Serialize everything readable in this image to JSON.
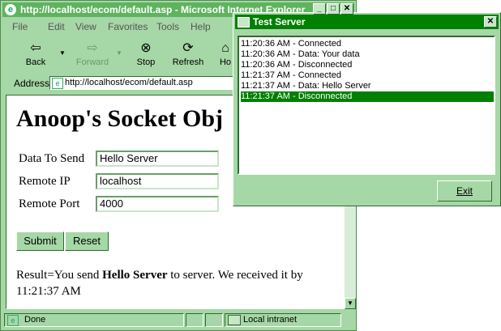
{
  "ie": {
    "title": "http://localhost/ecom/default.asp - Microsoft Internet Explorer",
    "menu": [
      "File",
      "Edit",
      "View",
      "Favorites",
      "Tools",
      "Help"
    ],
    "toolbar": {
      "back": "Back",
      "forward": "Forward",
      "stop": "Stop",
      "refresh": "Refresh",
      "home": "Ho"
    },
    "address": {
      "label": "Address",
      "url": "http://localhost/ecom/default.asp"
    },
    "page": {
      "heading": "Anoop's Socket Obj",
      "data_label": "Data To Send",
      "data_value": "Hello Server",
      "ip_label": "Remote IP",
      "ip_value": "localhost",
      "port_label": "Remote Port",
      "port_value": "4000",
      "submit": "Submit",
      "reset": "Reset",
      "result_prefix": "Result=You send ",
      "result_bold": "Hello Server",
      "result_suffix": " to server. We received it by 11:21:37 AM"
    },
    "status": {
      "text": "Done",
      "zone": "Local intranet"
    }
  },
  "server": {
    "title": "Test Server",
    "log": [
      "11:20:36 AM - Connected",
      "11:20:36 AM - Data: Your data",
      "11:20:36 AM - Disconnected",
      "11:21:37 AM - Connected",
      "11:21:37 AM - Data: Hello Server",
      "11:21:37 AM - Disconnected"
    ],
    "exit": "Exit"
  }
}
